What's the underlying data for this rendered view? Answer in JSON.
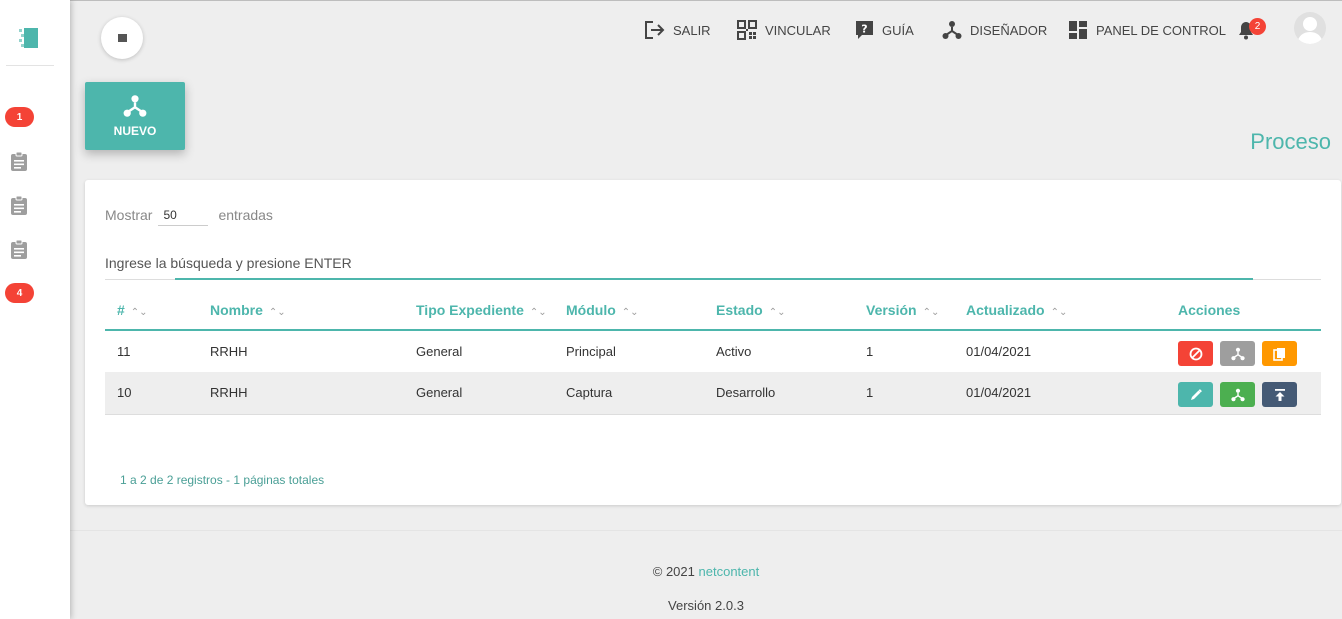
{
  "sidebar": {
    "badges": [
      "1",
      "4"
    ]
  },
  "topbar": {
    "nav": [
      {
        "label": "SALIR",
        "icon": "exit-icon"
      },
      {
        "label": "VINCULAR",
        "icon": "qr-code-icon"
      },
      {
        "label": "GUÍA",
        "icon": "help-icon"
      },
      {
        "label": "DISEÑADOR",
        "icon": "designer-icon"
      },
      {
        "label": "PANEL DE CONTROL",
        "icon": "dashboard-icon"
      }
    ],
    "notifications_count": "2"
  },
  "new_button_label": "NUEVO",
  "page_title": "Proceso",
  "table_controls": {
    "show_label": "Mostrar",
    "entries_value": "50",
    "entries_label": "entradas",
    "search_placeholder": "Ingrese la búsqueda y presione ENTER"
  },
  "table": {
    "headers": [
      "#",
      "Nombre",
      "Tipo Expediente",
      "Módulo",
      "Estado",
      "Versión",
      "Actualizado",
      "Acciones"
    ],
    "rows": [
      {
        "id": "11",
        "nombre": "RRHH",
        "tipo": "General",
        "modulo": "Principal",
        "estado": "Activo",
        "version": "1",
        "actualizado": "01/04/2021"
      },
      {
        "id": "10",
        "nombre": "RRHH",
        "tipo": "General",
        "modulo": "Captura",
        "estado": "Desarrollo",
        "version": "1",
        "actualizado": "01/04/2021"
      }
    ]
  },
  "pagination_text": "1 a 2 de 2 registros - 1 páginas totales",
  "footer": {
    "copyright": "© 2021",
    "brand": "netcontent",
    "version": "Versión 2.0.3"
  },
  "colors": {
    "accent": "#4db6ac",
    "danger": "#f44336",
    "warning": "#ff9800",
    "success": "#4caf50",
    "neutral": "#9e9e9e",
    "navy": "#455a75"
  }
}
